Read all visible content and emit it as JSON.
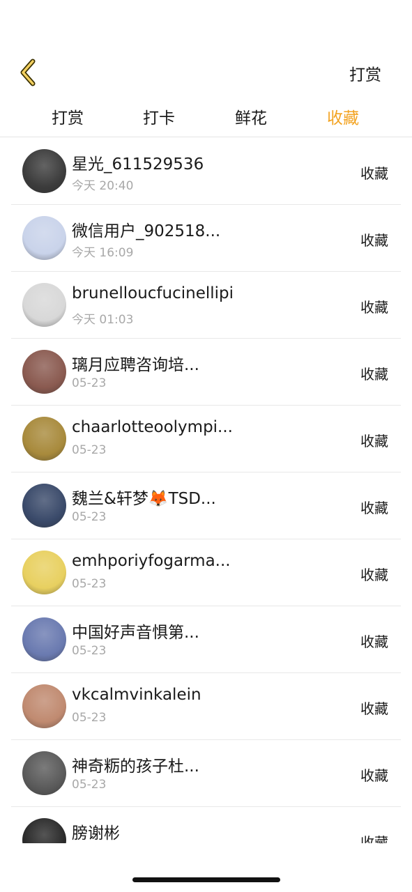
{
  "header": {
    "right_label": "打赏"
  },
  "tabs": [
    {
      "label": "打赏",
      "active": false
    },
    {
      "label": "打卡",
      "active": false
    },
    {
      "label": "鲜花",
      "active": false
    },
    {
      "label": "收藏",
      "active": true
    }
  ],
  "colors": {
    "accent": "#f3a321",
    "text": "#1a1a1a",
    "secondary": "#a8a8a8",
    "divider": "#e8e8e8"
  },
  "rows": [
    {
      "name": "星光_611529536",
      "time": "今天 20:40",
      "action": "收藏",
      "avatar_color": "#3c3c3c"
    },
    {
      "name": "微信用户_902518...",
      "time": "今天 16:09",
      "action": "收藏",
      "avatar_color": "#c9d3ea"
    },
    {
      "name": "brunelloucfucinellipi",
      "time": "今天 01:03",
      "action": "收藏",
      "avatar_color": "#d8d8d8"
    },
    {
      "name": "璃月应聘咨询培...",
      "time": "05-23",
      "action": "收藏",
      "avatar_color": "#8a5a50"
    },
    {
      "name": "chaarlotteoolympi...",
      "time": "05-23",
      "action": "收藏",
      "avatar_color": "#a88a3c"
    },
    {
      "name": "魏兰&轩梦🦊TSD...",
      "time": "05-23",
      "action": "收藏",
      "avatar_color": "#3a4a6a"
    },
    {
      "name": "emhporiyfogarma...",
      "time": "05-23",
      "action": "收藏",
      "avatar_color": "#e8d060"
    },
    {
      "name": "中国好声音惧第...",
      "time": "05-23",
      "action": "收藏",
      "avatar_color": "#6a7ab0"
    },
    {
      "name": "vkcalmvinkalein",
      "time": "05-23",
      "action": "收藏",
      "avatar_color": "#c08a70"
    },
    {
      "name": "神奇粝的孩子杜...",
      "time": "05-23",
      "action": "收藏",
      "avatar_color": "#5a5a5a"
    },
    {
      "name": "膀谢彬",
      "time": "",
      "action": "收藏",
      "avatar_color": "#2a2a2a"
    }
  ]
}
